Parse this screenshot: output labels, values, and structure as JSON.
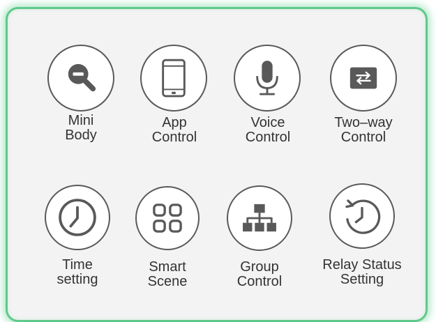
{
  "features": [
    {
      "id": "mini-body",
      "icon": "magnifier-minus-icon",
      "line1": "Mini",
      "line2": "Body"
    },
    {
      "id": "app-control",
      "icon": "smartphone-icon",
      "line1": "App",
      "line2": "Control"
    },
    {
      "id": "voice-control",
      "icon": "microphone-icon",
      "line1": "Voice",
      "line2": "Control"
    },
    {
      "id": "two-way-control",
      "icon": "two-way-arrows-icon",
      "line1": "Two–way",
      "line2": "Control"
    },
    {
      "id": "time-setting",
      "icon": "clock-icon",
      "line1": "Time",
      "line2": "setting"
    },
    {
      "id": "smart-scene",
      "icon": "four-squares-icon",
      "line1": "Smart",
      "line2": "Scene"
    },
    {
      "id": "group-control",
      "icon": "hierarchy-icon",
      "line1": "Group",
      "line2": "Control"
    },
    {
      "id": "relay-status-setting",
      "icon": "restore-clock-icon",
      "line1": "Relay Status",
      "line2": "Setting"
    }
  ],
  "colors": {
    "border": "#5fc98a",
    "panel": "#f3f3f3",
    "icon": "#595959",
    "text": "#333333"
  }
}
